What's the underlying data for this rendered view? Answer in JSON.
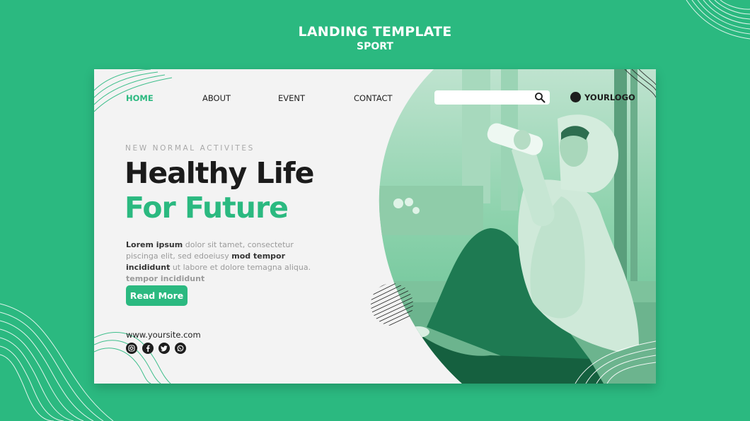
{
  "header": {
    "title": "LANDING TEMPLATE",
    "subtitle": "SPORT"
  },
  "nav": {
    "items": [
      "HOME",
      "ABOUT",
      "EVENT",
      "CONTACT"
    ],
    "active": "HOME"
  },
  "search": {
    "placeholder": "",
    "icon": "search-icon"
  },
  "logo": {
    "text": "YOURLOGO"
  },
  "hero": {
    "eyebrow": "NEW NORMAL ACTIVITES",
    "headline_line1": "Healthy Life",
    "headline_line2": "For Future",
    "body_lead": "Lorem ipsum",
    "body_part1": " dolor sit tamet, consectetur piscinga elit, sed edoeiusy ",
    "body_bold2": "mod tempor incididunt",
    "body_part2": " ut labore et dolore temagna aliqua.  ",
    "body_bold3": "tempor incididunt",
    "cta_label": "Read More"
  },
  "footer": {
    "url": "www.yoursite.com",
    "socials": [
      "instagram-icon",
      "facebook-icon",
      "twitter-icon",
      "whatsapp-icon"
    ]
  },
  "colors": {
    "background": "#2bb980",
    "accent": "#2bb980",
    "card": "#f3f3f3",
    "text_dark": "#1b1b1b",
    "text_muted": "#9a9a9a"
  }
}
